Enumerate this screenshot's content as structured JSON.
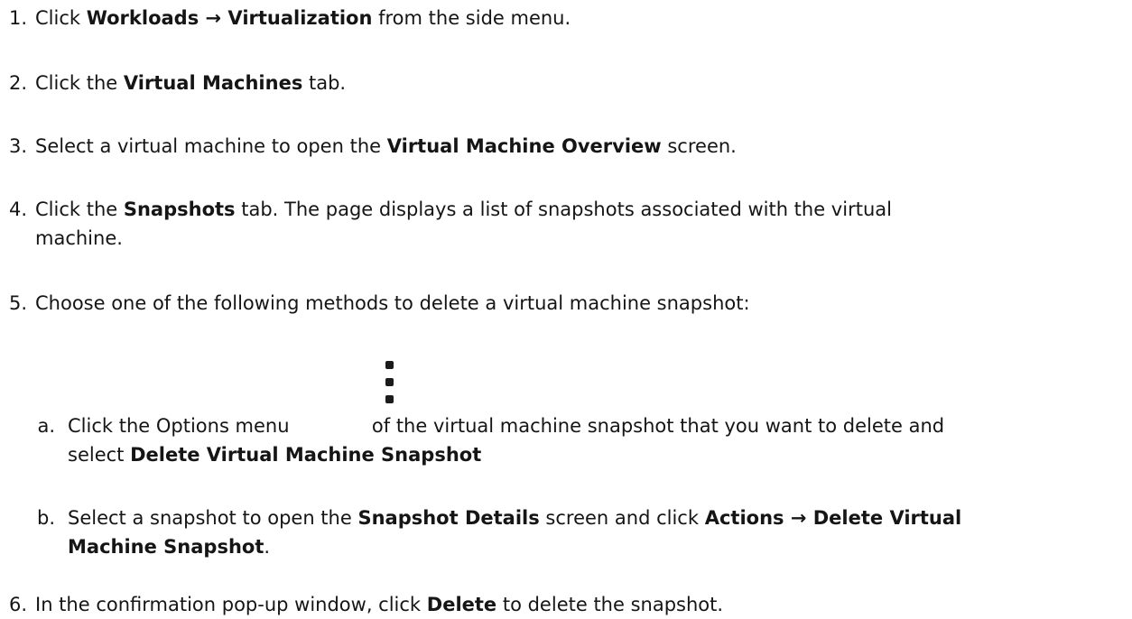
{
  "steps": [
    {
      "num": "1.",
      "pre": "Click ",
      "b1": "Workloads → Virtualization",
      "post": " from the side menu."
    },
    {
      "num": "2.",
      "pre": "Click the ",
      "b1": "Virtual Machines",
      "post": " tab."
    },
    {
      "num": "3.",
      "pre": "Select a virtual machine to open the ",
      "b1": "Virtual Machine Overview",
      "post": " screen."
    },
    {
      "num": "4.",
      "pre": "Click the ",
      "b1": "Snapshots",
      "post": " tab. The page displays a list of snapshots associated with the virtual",
      "line2": "machine."
    },
    {
      "num": "5.",
      "text": "Choose one of the following methods to delete a virtual machine snapshot:"
    },
    {
      "num": "6.",
      "pre": "In the confirmation pop-up window, click ",
      "b1": "Delete",
      "post": " to delete the snapshot."
    }
  ],
  "substeps": [
    {
      "num": "a.",
      "pre": "Click the Options menu ",
      "mid": " of the virtual machine snapshot that you want to delete and",
      "line2_pre": "select ",
      "line2_b": "Delete Virtual Machine Snapshot",
      "icon": "kebab-icon"
    },
    {
      "num": "b.",
      "pre": "Select a snapshot to open the ",
      "b1": "Snapshot Details",
      "mid": " screen and click ",
      "b2": "Actions → Delete Virtual",
      "line2_b": "Machine Snapshot",
      "line2_post": "."
    }
  ]
}
